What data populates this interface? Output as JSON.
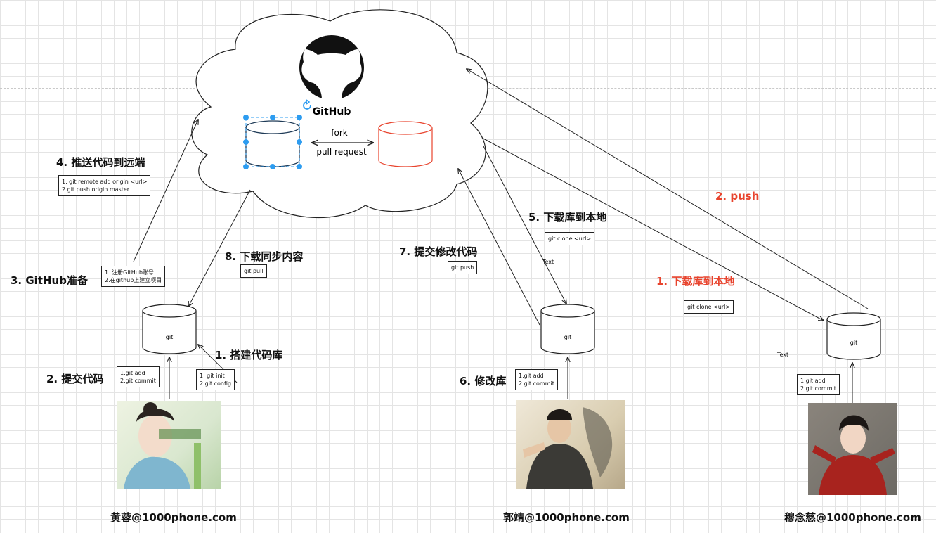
{
  "github": {
    "logo_text": "GitHub"
  },
  "remote_repo": {
    "arrow_top": "fork",
    "arrow_bottom": "pull request"
  },
  "steps_left": {
    "s1": "1. 搭建代码库",
    "s1_cmd": "1. git init\n2.git config",
    "s2": "2. 提交代码",
    "s2_cmd": "1.git add\n2.git commit",
    "s3": "3. GitHub准备",
    "s3_cmd": "1. 注册GitHub账号\n2.在github上建立项目",
    "s4": "4. 推送代码到远端",
    "s4_cmd": "1. git remote add origin <url>\n2.git push origin master",
    "s8": "8. 下载同步内容",
    "s8_cmd": "git pull"
  },
  "steps_middle": {
    "s5": "5. 下载库到本地",
    "s5_cmd": "git clone <url>",
    "s6": "6. 修改库",
    "s6_cmd": "1.git add\n2.git commit",
    "s7": "7. 提交修改代码",
    "s7_cmd": "git push",
    "text_mark": "Text"
  },
  "steps_right": {
    "s1": "1. 下载库到本地",
    "s1_cmd": "git clone <url>",
    "s2": "2. push",
    "cmd": "1.git add\n2.git commit",
    "text_mark": "Text"
  },
  "local_repos": {
    "label": "git"
  },
  "users": [
    {
      "email": "黄蓉@1000phone.com"
    },
    {
      "email": "郭靖@1000phone.com"
    },
    {
      "email": "穆念慈@1000phone.com"
    }
  ],
  "colors": {
    "accent_red": "#e8432d",
    "selection_blue": "#2d9cf0",
    "line": "#222222"
  }
}
